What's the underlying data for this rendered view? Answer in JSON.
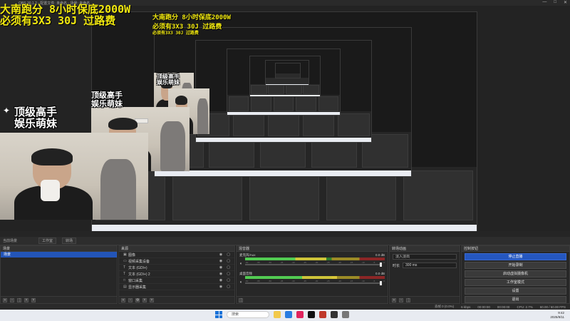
{
  "window": {
    "title": "OBS 30.1.2 - 配置文件: 未命名 - 场景: 未命名",
    "controls": [
      "—",
      "□",
      "✕"
    ]
  },
  "overlay": {
    "line1": "大南跑分 8小时保底2000W",
    "line2": "必须有3X3 30J 过路费"
  },
  "webcam": {
    "label_line1": "顶级高手",
    "label_line2": "娱乐萌妹"
  },
  "collection_bar": {
    "title": "当前场景",
    "buttons": [
      "工作室",
      "转场"
    ]
  },
  "scenes": {
    "header": "场景",
    "items": [
      {
        "label": "场景",
        "selected": true
      }
    ]
  },
  "sources": {
    "header": "来源",
    "items": [
      {
        "icon": "image-icon",
        "label": "图像"
      },
      {
        "icon": "video-capture-icon",
        "label": "视频采集设备"
      },
      {
        "icon": "text-icon",
        "label": "文本 (GDI+)"
      },
      {
        "icon": "text-icon",
        "label": "文本 (GDI+) 2"
      },
      {
        "icon": "window-icon",
        "label": "窗口采集"
      },
      {
        "icon": "display-icon",
        "label": "显示器采集"
      }
    ]
  },
  "mixer": {
    "header": "混音器",
    "channels": [
      {
        "name": "麦克风/Aux",
        "db": "0.0 dB",
        "level": 0.58,
        "volume": 1.0
      },
      {
        "name": "桌面音频",
        "db": "0.0 dB",
        "level": 0.66,
        "volume": 1.0
      }
    ],
    "ticks": [
      "-60",
      "-55",
      "-50",
      "-45",
      "-40",
      "-35",
      "-30",
      "-25",
      "-20",
      "-15",
      "-10",
      "-5",
      "0"
    ]
  },
  "transitions": {
    "header": "转场动画",
    "type": "淡入淡出",
    "duration_label": "时长",
    "duration": "300 ms"
  },
  "controls": {
    "header": "控制按钮",
    "buttons": [
      {
        "label": "停止直播",
        "primary": true
      },
      {
        "label": "开始录制",
        "primary": false
      },
      {
        "label": "启动虚拟摄像机",
        "primary": false
      },
      {
        "label": "工作室模式",
        "primary": false
      },
      {
        "label": "设置",
        "primary": false
      },
      {
        "label": "退出",
        "primary": false
      }
    ]
  },
  "statusbar": {
    "dropped": "丢帧 0 (0.0%)",
    "bitrate": "6 kbps",
    "live_time": "00:00:00",
    "rec_time": "00:00:00",
    "cpu": "CPU: 2.7%",
    "fps": "60.00 / 60.00 FPS"
  },
  "taskbar": {
    "search_placeholder": "搜索",
    "time": "9:42",
    "date": "2025/8/11"
  },
  "colors": {
    "accent": "#2557c0",
    "overlay_text": "#f1e80f"
  }
}
